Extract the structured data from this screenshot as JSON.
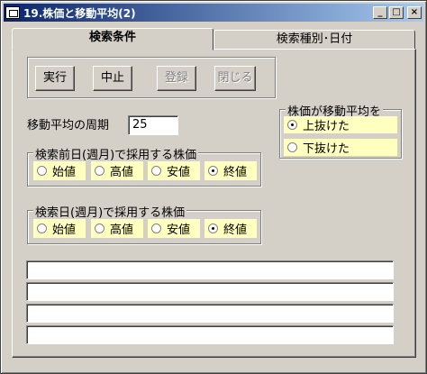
{
  "window": {
    "title": "19.株価と移動平均(2)",
    "buttons": {
      "minimize": "_",
      "maximize": "□",
      "close": "×"
    }
  },
  "tabs": [
    {
      "label": "検索条件",
      "active": true
    },
    {
      "label": "検索種別･日付",
      "active": false
    }
  ],
  "toolbar": {
    "run_label": "実行",
    "stop_label": "中止",
    "register_label": "登録",
    "close_label": "閉じる"
  },
  "period": {
    "label": "移動平均の周期",
    "value": "25"
  },
  "prev_day_group": {
    "title": "検索前日(週月)で採用する株価",
    "options": [
      "始値",
      "高値",
      "安値",
      "終値"
    ],
    "selected": "終値"
  },
  "day_group": {
    "title": "検索日(週月)で採用する株価",
    "options": [
      "始値",
      "高値",
      "安値",
      "終値"
    ],
    "selected": "終値"
  },
  "cross_group": {
    "title": "株価が移動平均を",
    "options": [
      "上抜けた",
      "下抜けた"
    ],
    "selected": "上抜けた"
  },
  "output_lines": [
    "",
    "",
    "",
    ""
  ],
  "colors": {
    "titlebar_start": "#0a246a",
    "titlebar_end": "#a6caf0",
    "radio_highlight": "#ffffc0",
    "face": "#d4d0c8"
  }
}
